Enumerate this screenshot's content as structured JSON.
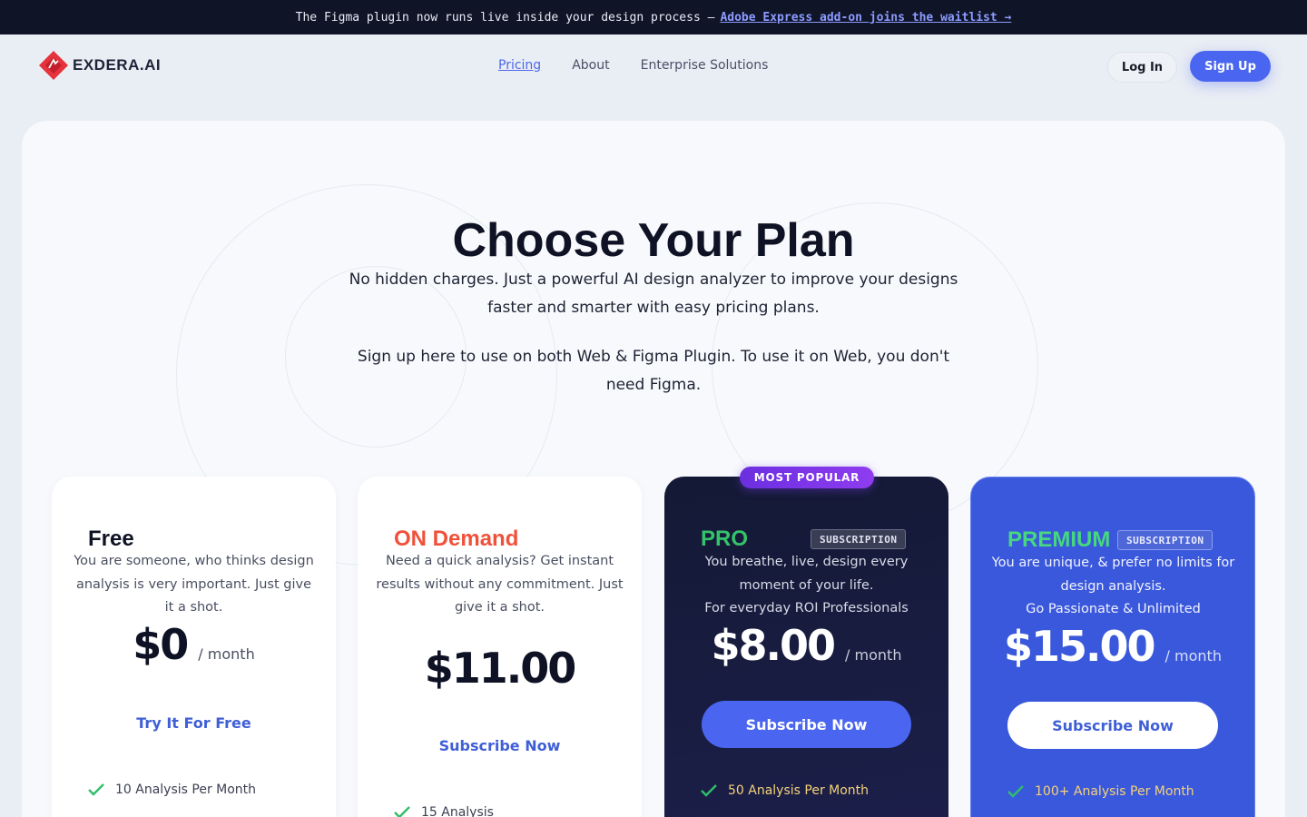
{
  "announcement": {
    "text": "The Figma plugin now runs live inside your design process —",
    "link": "Adobe Express add-on joins the waitlist →"
  },
  "nav": {
    "logo": "EXDERA.AI",
    "links": [
      "Pricing",
      "About",
      "Enterprise Solutions"
    ],
    "login": "Log In",
    "signup": "Sign Up"
  },
  "hero": {
    "title": "Choose Your Plan",
    "subtitle": "No hidden charges. Just a powerful AI design analyzer to improve your designs faster and smarter with easy pricing plans.",
    "subtitle2": "Sign up here to use on both Web & Figma Plugin. To use it on Web, you don't need Figma."
  },
  "popular_badge": "MOST POPULAR",
  "plans": [
    {
      "name": "Free",
      "desc": "You are someone, who thinks design analysis is very important. Just give it a shot.",
      "price": "$0",
      "period": "/ month",
      "cta": "Try It For Free",
      "feature": "10 Analysis Per Month"
    },
    {
      "name": "ON Demand",
      "desc": "Need a quick analysis? Get instant results without any commitment. Just give it a shot.",
      "price": "$11.00",
      "cta": "Subscribe Now",
      "feature": "15 Analysis"
    },
    {
      "name": "PRO",
      "badge": "SUBSCRIPTION",
      "desc": "You breathe, live, design every moment of your life.",
      "desc2": "For everyday ROI Professionals",
      "price": "$8.00",
      "period": "/ month",
      "cta": "Subscribe Now",
      "feature": "50 Analysis Per Month"
    },
    {
      "name": "PREMIUM",
      "badge": "SUBSCRIPTION",
      "desc": "You are unique, & prefer no limits for design analysis.",
      "desc2": "Go Passionate & Unlimited",
      "price": "$15.00",
      "period": "/ month",
      "cta": "Subscribe Now",
      "feature": "100+ Analysis Per Month"
    }
  ],
  "colors": {
    "accent": "#4a66f0",
    "ondemand": "#f0513a",
    "pro": "#34c26a",
    "premium": "#46d77f",
    "feature_highlight": "#f5d27a"
  }
}
